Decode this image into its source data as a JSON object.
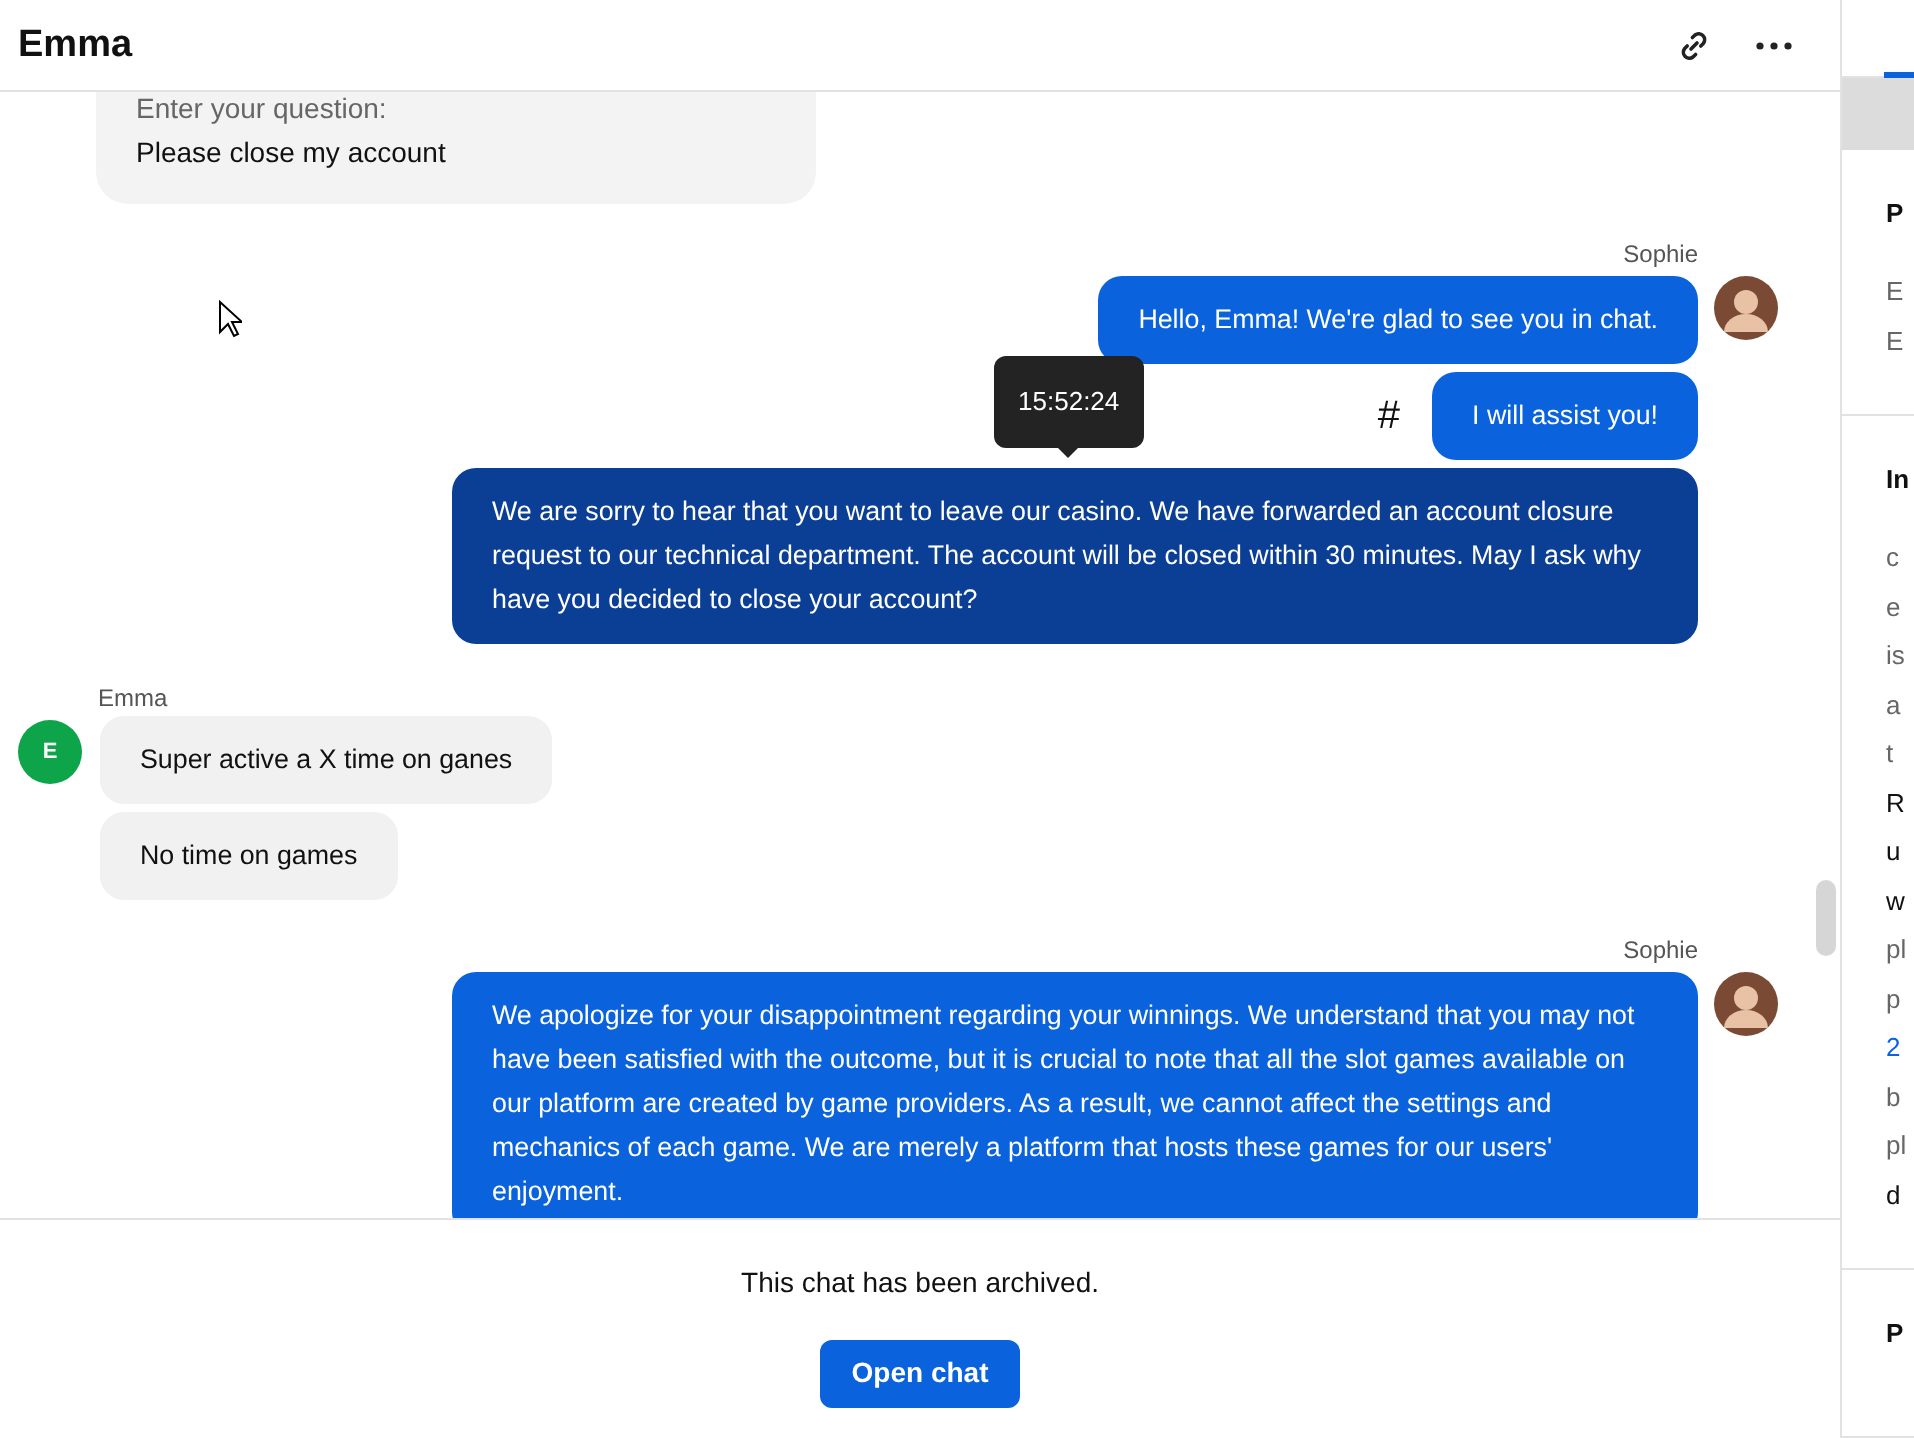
{
  "header": {
    "title": "Emma"
  },
  "messages": [
    {
      "kind": "form",
      "label": "Enter your question:",
      "value": "Please close my account"
    },
    {
      "kind": "agent",
      "author": "Sophie",
      "bubbles": [
        {
          "text": "Hello, Emma! We're glad to see you in chat.",
          "highlighted": false
        },
        {
          "text": "I will assist you!",
          "highlighted": false,
          "marker": "#"
        },
        {
          "text": "We are sorry to hear that you want to leave our casino. We have forwarded an account closure request to our technical department. The account will be closed within 30 minutes. May I ask why have you decided to close your account?",
          "highlighted": true,
          "tooltip": "15:52:24"
        }
      ]
    },
    {
      "kind": "customer",
      "author": "Emma",
      "initial": "E",
      "bubbles": [
        {
          "text": "Super active a X time on ganes",
          "highlighted": false
        },
        {
          "text": "No time on games",
          "highlighted": false
        }
      ]
    },
    {
      "kind": "agent",
      "author": "Sophie",
      "bubbles": [
        {
          "text": "We apologize for your disappointment regarding your winnings. We understand that you may not have been satisfied with the outcome, but it is crucial to note that all the slot games available on our platform are created by game providers. As a result, we cannot affect the settings and mechanics of each game. We are merely a platform that hosts these games for our users' enjoyment.",
          "highlighted": false
        }
      ]
    }
  ],
  "footer": {
    "notice": "This chat has been archived.",
    "button": "Open chat"
  },
  "sidebar": {
    "sections": [
      {
        "heading": "P",
        "lines": [
          {
            "text": "E",
            "kind": "muted"
          },
          {
            "text": "E",
            "kind": "muted"
          }
        ]
      },
      {
        "heading": "In",
        "lines": [
          {
            "text": "c",
            "kind": "muted"
          },
          {
            "text": "e",
            "kind": "muted"
          },
          {
            "text": "is",
            "kind": "muted"
          },
          {
            "text": "a",
            "kind": "muted"
          },
          {
            "text": "t",
            "kind": "muted"
          },
          {
            "text": "R",
            "kind": "strong"
          },
          {
            "text": "u",
            "kind": "strong"
          },
          {
            "text": "w",
            "kind": "strong"
          },
          {
            "text": "pl",
            "kind": "muted"
          },
          {
            "text": "p",
            "kind": "muted"
          },
          {
            "text": "2",
            "kind": "link"
          },
          {
            "text": "b",
            "kind": "muted"
          },
          {
            "text": "pl",
            "kind": "muted"
          },
          {
            "text": "d",
            "kind": "strong"
          }
        ]
      },
      {
        "heading": "P"
      }
    ]
  }
}
